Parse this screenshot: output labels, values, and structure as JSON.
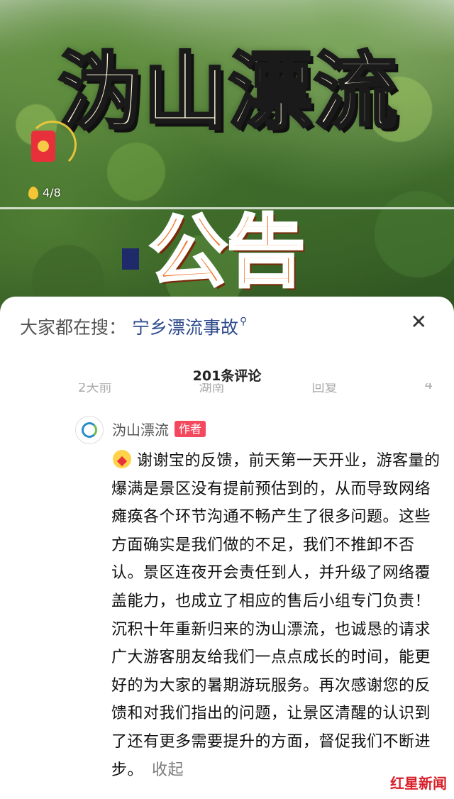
{
  "video": {
    "title": "沩山漂流",
    "subtitle": "公告",
    "coin_counter": "4/8"
  },
  "search": {
    "prefix": "大家都在搜：",
    "query": "宁乡漂流事故"
  },
  "comments": {
    "count_label": "201条评论",
    "clipped_row": [
      "2天前",
      "湖南",
      "回复",
      "4"
    ],
    "items": [
      {
        "author": "沩山漂流",
        "badge": "作者",
        "text": "谢谢宝的反馈，前天第一天开业，游客量的爆满是景区没有提前预估到的，从而导致网络瘫痪各个环节沟通不畅产生了很多问题。这些方面确实是我们做的不足，我们不推卸不否认。景区连夜开会责任到人，并升级了网络覆盖能力，也成立了相应的售后小组专门负责！沉积十年重新归来的沩山漂流，也诚恳的请求广大游客朋友给我们一点点成长的时间，能更好的为大家的暑期游玩服务。再次感谢您的反馈和对我们指出的问题，让景区清醒的认识到了还有更多需要提升的方面，督促我们不断进步。",
        "collapse_label": "收起"
      }
    ]
  },
  "watermark": {
    "text": "红星新闻"
  },
  "icons": {
    "search_suffix": "search-icon",
    "close": "close-icon",
    "red_packet": "red-packet-icon",
    "coin": "coin-icon",
    "emoji": "heart-face-emoji-icon"
  },
  "colors": {
    "search_link": "#2f4b8c",
    "badge": "#f4485e",
    "watermark": "#d8202a"
  }
}
